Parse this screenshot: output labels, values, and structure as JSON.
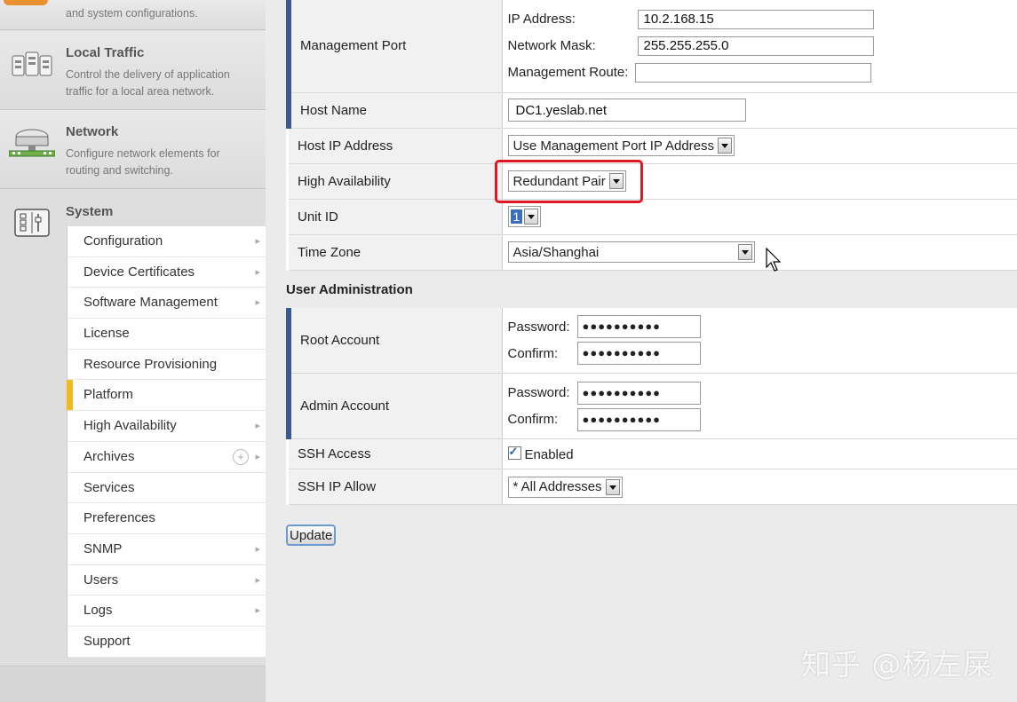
{
  "sidebar": {
    "top_desc": "and system configurations.",
    "local_traffic": {
      "title": "Local Traffic",
      "desc": "Control the delivery of application traffic for a local area network."
    },
    "network": {
      "title": "Network",
      "desc": "Configure network elements for routing and switching."
    },
    "system": {
      "title": "System"
    },
    "menu": [
      {
        "label": "Configuration",
        "arrow": true
      },
      {
        "label": "Device Certificates",
        "arrow": true
      },
      {
        "label": "Software Management",
        "arrow": true
      },
      {
        "label": "License",
        "arrow": false
      },
      {
        "label": "Resource Provisioning",
        "arrow": false
      },
      {
        "label": "Platform",
        "arrow": false,
        "active": true
      },
      {
        "label": "High Availability",
        "arrow": true
      },
      {
        "label": "Archives",
        "arrow": true,
        "plus": true
      },
      {
        "label": "Services",
        "arrow": false
      },
      {
        "label": "Preferences",
        "arrow": false
      },
      {
        "label": "SNMP",
        "arrow": true
      },
      {
        "label": "Users",
        "arrow": true
      },
      {
        "label": "Logs",
        "arrow": true
      },
      {
        "label": "Support",
        "arrow": false
      }
    ],
    "arrow_glyph": "▸",
    "plus_glyph": "+"
  },
  "general": {
    "management_port": {
      "label": "Management Port",
      "ip_label": "IP Address:",
      "ip_value": "10.2.168.15",
      "mask_label": "Network Mask:",
      "mask_value": "255.255.255.0",
      "route_label": "Management Route:",
      "route_value": ""
    },
    "host_name": {
      "label": "Host Name",
      "value": "DC1.yeslab.net"
    },
    "host_ip": {
      "label": "Host IP Address",
      "value": "Use Management Port IP Address"
    },
    "high_availability": {
      "label": "High Availability",
      "value": "Redundant Pair"
    },
    "unit_id": {
      "label": "Unit ID",
      "value": "1"
    },
    "time_zone": {
      "label": "Time Zone",
      "value": "Asia/Shanghai"
    }
  },
  "user_admin": {
    "title": "User Administration",
    "root": {
      "label": "Root Account",
      "password_label": "Password:",
      "password_value": "●●●●●●●●●●",
      "confirm_label": "Confirm:",
      "confirm_value": "●●●●●●●●●●"
    },
    "admin": {
      "label": "Admin Account",
      "password_label": "Password:",
      "password_value": "●●●●●●●●●●",
      "confirm_label": "Confirm:",
      "confirm_value": "●●●●●●●●●●"
    },
    "ssh_access": {
      "label": "SSH Access",
      "value": "Enabled",
      "checked": true
    },
    "ssh_ip_allow": {
      "label": "SSH IP Allow",
      "value": "* All Addresses"
    }
  },
  "update_label": "Update",
  "watermark": "知乎 @杨左屎",
  "colors": {
    "required_bar": "#3a5a8c",
    "active_item": "#f1b91d",
    "highlight_box": "#e0171f",
    "category_tab": "#e8912e"
  },
  "icons": {
    "local_traffic": "server-rack-icon",
    "network": "network-device-icon",
    "system": "system-sliders-icon",
    "cursor": "mouse-pointer-icon"
  }
}
